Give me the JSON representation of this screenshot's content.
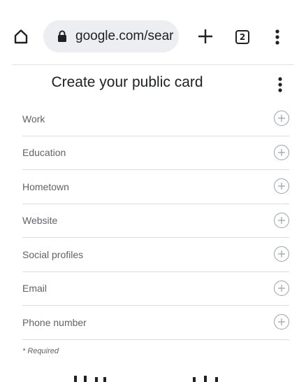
{
  "browser": {
    "url": "google.com/sear",
    "tab_count": "2",
    "icons": [
      "home-icon",
      "lock-icon",
      "plus-icon",
      "tab-switcher-icon",
      "overflow-menu-icon"
    ]
  },
  "card": {
    "title": "Create your public card",
    "fields": [
      {
        "label": "Work"
      },
      {
        "label": "Education"
      },
      {
        "label": "Hometown"
      },
      {
        "label": "Website"
      },
      {
        "label": "Social profiles"
      },
      {
        "label": "Email"
      },
      {
        "label": "Phone number"
      }
    ],
    "required_note": "* Required"
  },
  "colors": {
    "urlbar_bg": "#eceef1",
    "divider": "#dadce0",
    "label_text": "#5f6368",
    "title_text": "#202124"
  }
}
